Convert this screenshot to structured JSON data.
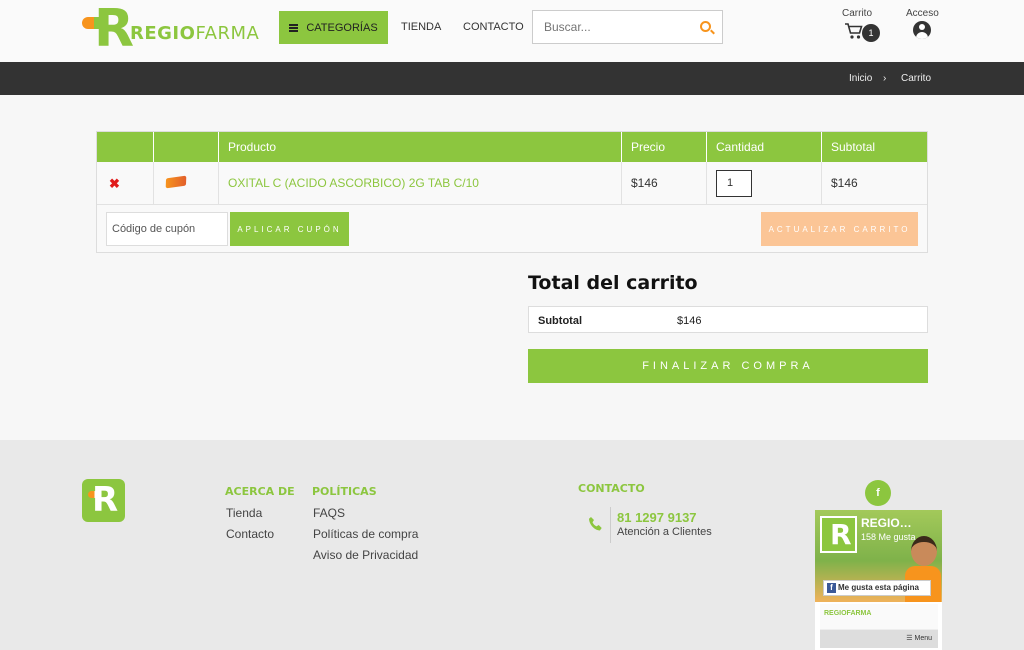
{
  "header": {
    "logo_bold": "REGIO",
    "logo_light": "FARMA",
    "categories_label": "CATEGORÍAS",
    "nav": [
      "TIENDA",
      "CONTACTO"
    ],
    "search_placeholder": "Buscar...",
    "cart_label": "Carrito",
    "cart_count": "1",
    "account_label": "Acceso"
  },
  "breadcrumb": {
    "home": "Inicio",
    "sep": "›",
    "current": "Carrito"
  },
  "cart": {
    "columns": [
      "Producto",
      "Precio",
      "Cantidad",
      "Subtotal"
    ],
    "item": {
      "remove": "✖",
      "name": "OXITAL C (ACIDO ASCORBICO) 2G TAB C/10",
      "price": "$146",
      "quantity": "1",
      "subtotal": "$146"
    },
    "coupon_placeholder": "Código de cupón",
    "apply_coupon": "APLICAR CUPÓN",
    "update_cart": "ACTUALIZAR CARRITO"
  },
  "totals": {
    "title": "Total del carrito",
    "subtotal_label": "Subtotal",
    "subtotal_value": "$146",
    "checkout": "FINALIZAR COMPRA"
  },
  "footer": {
    "about_heading": "ACERCA DE",
    "about_links": [
      "Tienda",
      "Contacto"
    ],
    "policies_heading": "POLÍTICAS",
    "policies_links": [
      "FAQS",
      "Políticas de compra",
      "Aviso de Privacidad"
    ],
    "contact_heading": "CONTACTO",
    "phone": "81 1297 9137",
    "phone_sub": "Atención a Clientes",
    "fb_icon": "f",
    "fb_page_name": "REGIO…",
    "fb_likes": "158 Me gusta",
    "fb_like_button": "Me gusta esta página",
    "fb_mini_logo": "REGIOFARMA",
    "fb_menu": "☰ Menu"
  },
  "colors": {
    "brand_green": "#8cc63f",
    "brand_orange": "#f7941d",
    "dark_bar": "#333333"
  }
}
